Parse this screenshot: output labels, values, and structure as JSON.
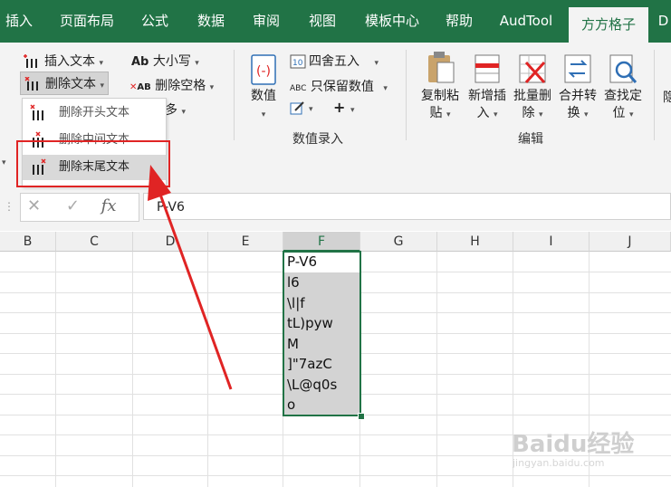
{
  "tabs": [
    "插入",
    "页面布局",
    "公式",
    "数据",
    "审阅",
    "视图",
    "模板中心",
    "帮助",
    "AudTool",
    "方方格子",
    "D"
  ],
  "active_tab": "方方格子",
  "ribbon": {
    "insert_text": "插入文本",
    "delete_text": "删除文本",
    "case": "大小写",
    "delete_space": "删除空格",
    "more": "多",
    "round": "四舍五入",
    "keep_value": "只保留数值",
    "value_big": "数值",
    "plus": "+",
    "group_value_input": "数值录入",
    "copy_paste": [
      "复制粘",
      "贴"
    ],
    "add_insert": [
      "新增插",
      "入"
    ],
    "batch_delete": [
      "批量删",
      "除"
    ],
    "merge_convert": [
      "合并转",
      "换"
    ],
    "find_locate": [
      "查找定",
      "位"
    ],
    "group_edit": "编辑",
    "partial": "隐"
  },
  "menu": {
    "items": [
      "删除开头文本",
      "删除中间文本",
      "删除末尾文本"
    ],
    "hover_index": 2
  },
  "formula_bar": {
    "cancel": "✕",
    "enter": "✓",
    "fx": "fx",
    "content": "P-V6"
  },
  "columns": [
    "B",
    "C",
    "D",
    "E",
    "F",
    "G",
    "H",
    "I",
    "J"
  ],
  "selected_column": "F",
  "cells_F": [
    "P-V6",
    "l6",
    "\\l|f",
    "tL)pyw",
    "M",
    "]\"7azC",
    "\\L@q0s",
    "o"
  ],
  "watermark": "Baidu经验",
  "watermark_url": "jingyan.baidu.com",
  "colors": {
    "excel_green": "#217346",
    "highlight_red": "#e02424"
  }
}
